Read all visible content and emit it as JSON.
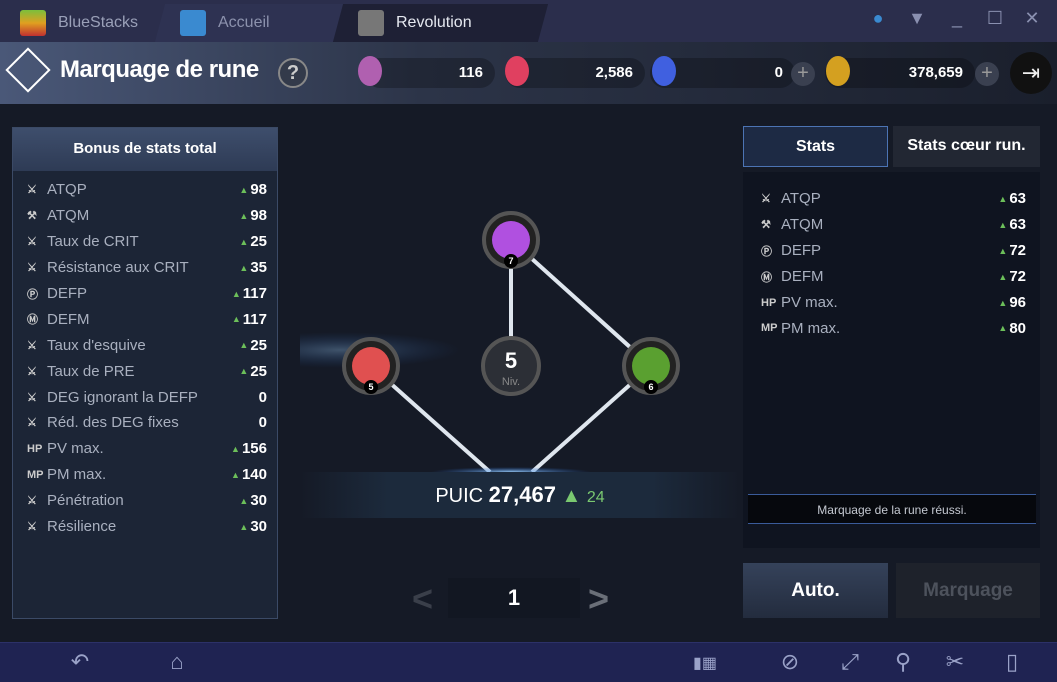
{
  "window": {
    "tabs": [
      {
        "label": "BlueStacks"
      },
      {
        "label": "Accueil"
      },
      {
        "label": "Revolution"
      }
    ]
  },
  "header": {
    "title": "Marquage de rune",
    "help": "?",
    "currencies": [
      {
        "icon": "purple-stone-icon",
        "value": "116",
        "color": "#c060c0"
      },
      {
        "icon": "red-gem-icon",
        "value": "2,586",
        "color": "#e04060"
      },
      {
        "icon": "blue-gem-icon",
        "value": "0",
        "color": "#4060e0"
      },
      {
        "icon": "gold-coin-icon",
        "value": "378,659",
        "color": "#d4a020"
      }
    ]
  },
  "left_panel": {
    "title": "Bonus de stats total",
    "stats": [
      {
        "icon": "swords",
        "label": "ATQP",
        "value": "98",
        "up": true
      },
      {
        "icon": "wand",
        "label": "ATQM",
        "value": "98",
        "up": true
      },
      {
        "icon": "swords",
        "label": "Taux de CRIT",
        "value": "25",
        "up": true
      },
      {
        "icon": "swords",
        "label": "Résistance aux CRIT",
        "value": "35",
        "up": true
      },
      {
        "icon": "shield-p",
        "label": "DEFP",
        "value": "117",
        "up": true
      },
      {
        "icon": "shield-m",
        "label": "DEFM",
        "value": "117",
        "up": true
      },
      {
        "icon": "swords",
        "label": "Taux d'esquive",
        "value": "25",
        "up": true
      },
      {
        "icon": "swords",
        "label": "Taux de PRE",
        "value": "25",
        "up": true
      },
      {
        "icon": "swords",
        "label": "DEG ignorant la DEFP",
        "value": "0",
        "up": false
      },
      {
        "icon": "swords",
        "label": "Réd. des DEG fixes",
        "value": "0",
        "up": false
      },
      {
        "icon": "HP",
        "label": "PV max.",
        "value": "156",
        "up": true
      },
      {
        "icon": "MP",
        "label": "PM max.",
        "value": "140",
        "up": true
      },
      {
        "icon": "swords",
        "label": "Pénétration",
        "value": "30",
        "up": true
      },
      {
        "icon": "swords",
        "label": "Résilience",
        "value": "30",
        "up": true
      }
    ]
  },
  "graph": {
    "top_rune_level": "7",
    "left_rune_level": "5",
    "right_rune_level": "6",
    "center_level": "5",
    "center_label": "Niv.",
    "power_label": "PUIC",
    "power": "27,467",
    "power_delta": "24",
    "page": "1"
  },
  "right_panel": {
    "tabs": [
      {
        "label": "Stats",
        "active": true
      },
      {
        "label": "Stats cœur run.",
        "active": false
      }
    ],
    "stats": [
      {
        "icon": "swords",
        "label": "ATQP",
        "value": "63"
      },
      {
        "icon": "wand",
        "label": "ATQM",
        "value": "63"
      },
      {
        "icon": "shield-p",
        "label": "DEFP",
        "value": "72"
      },
      {
        "icon": "shield-m",
        "label": "DEFM",
        "value": "72"
      },
      {
        "icon": "HP",
        "label": "PV max.",
        "value": "96"
      },
      {
        "icon": "MP",
        "label": "PM max.",
        "value": "80"
      }
    ],
    "message": "Marquage de la rune réussi.",
    "auto_label": "Auto.",
    "mark_label": "Marquage"
  }
}
